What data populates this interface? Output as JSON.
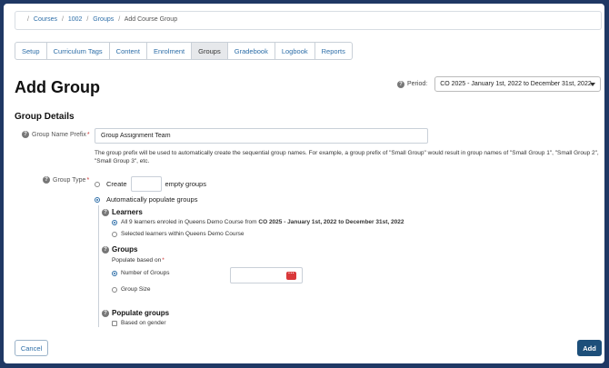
{
  "breadcrumb": {
    "items": [
      "Courses",
      "1002",
      "Groups",
      "Add Course Group"
    ]
  },
  "tabs": [
    "Setup",
    "Curriculum Tags",
    "Content",
    "Enrolment",
    "Groups",
    "Gradebook",
    "Logbook",
    "Reports"
  ],
  "active_tab": "Groups",
  "page_title": "Add Group",
  "period": {
    "label": "Period:",
    "value": "CO 2025 - January 1st, 2022 to December 31st, 2022"
  },
  "section_title": "Group Details",
  "prefix": {
    "label": "Group Name Prefix",
    "value": "Group Assignment Team",
    "help": "The group prefix will be used to automatically create the sequential group names. For example, a group prefix of \"Small Group\" would result in group names of \"Small Group 1\", \"Small Group 2\", \"Small Group 3\", etc."
  },
  "group_type": {
    "label": "Group Type",
    "create_label": "Create",
    "create_suffix": "empty groups",
    "auto_label": "Automatically populate groups"
  },
  "learners": {
    "title": "Learners",
    "all_prefix": "All 9 learners enroled in Queens Demo Course from ",
    "all_bold": "CO 2025 - January 1st, 2022 to December 31st, 2022",
    "selected": "Selected learners within Queens Demo Course"
  },
  "groups": {
    "title": "Groups",
    "populate_label": "Populate based on",
    "number_label": "Number of Groups",
    "size_label": "Group Size"
  },
  "populate_groups": {
    "title": "Populate groups",
    "gender_label": "Based on gender"
  },
  "buttons": {
    "cancel": "Cancel",
    "add": "Add"
  },
  "colors": {
    "frame": "#1f3864",
    "link": "#2d6ea8",
    "primary_button": "#1d4f7a",
    "dots_icon": "#d9383a"
  }
}
